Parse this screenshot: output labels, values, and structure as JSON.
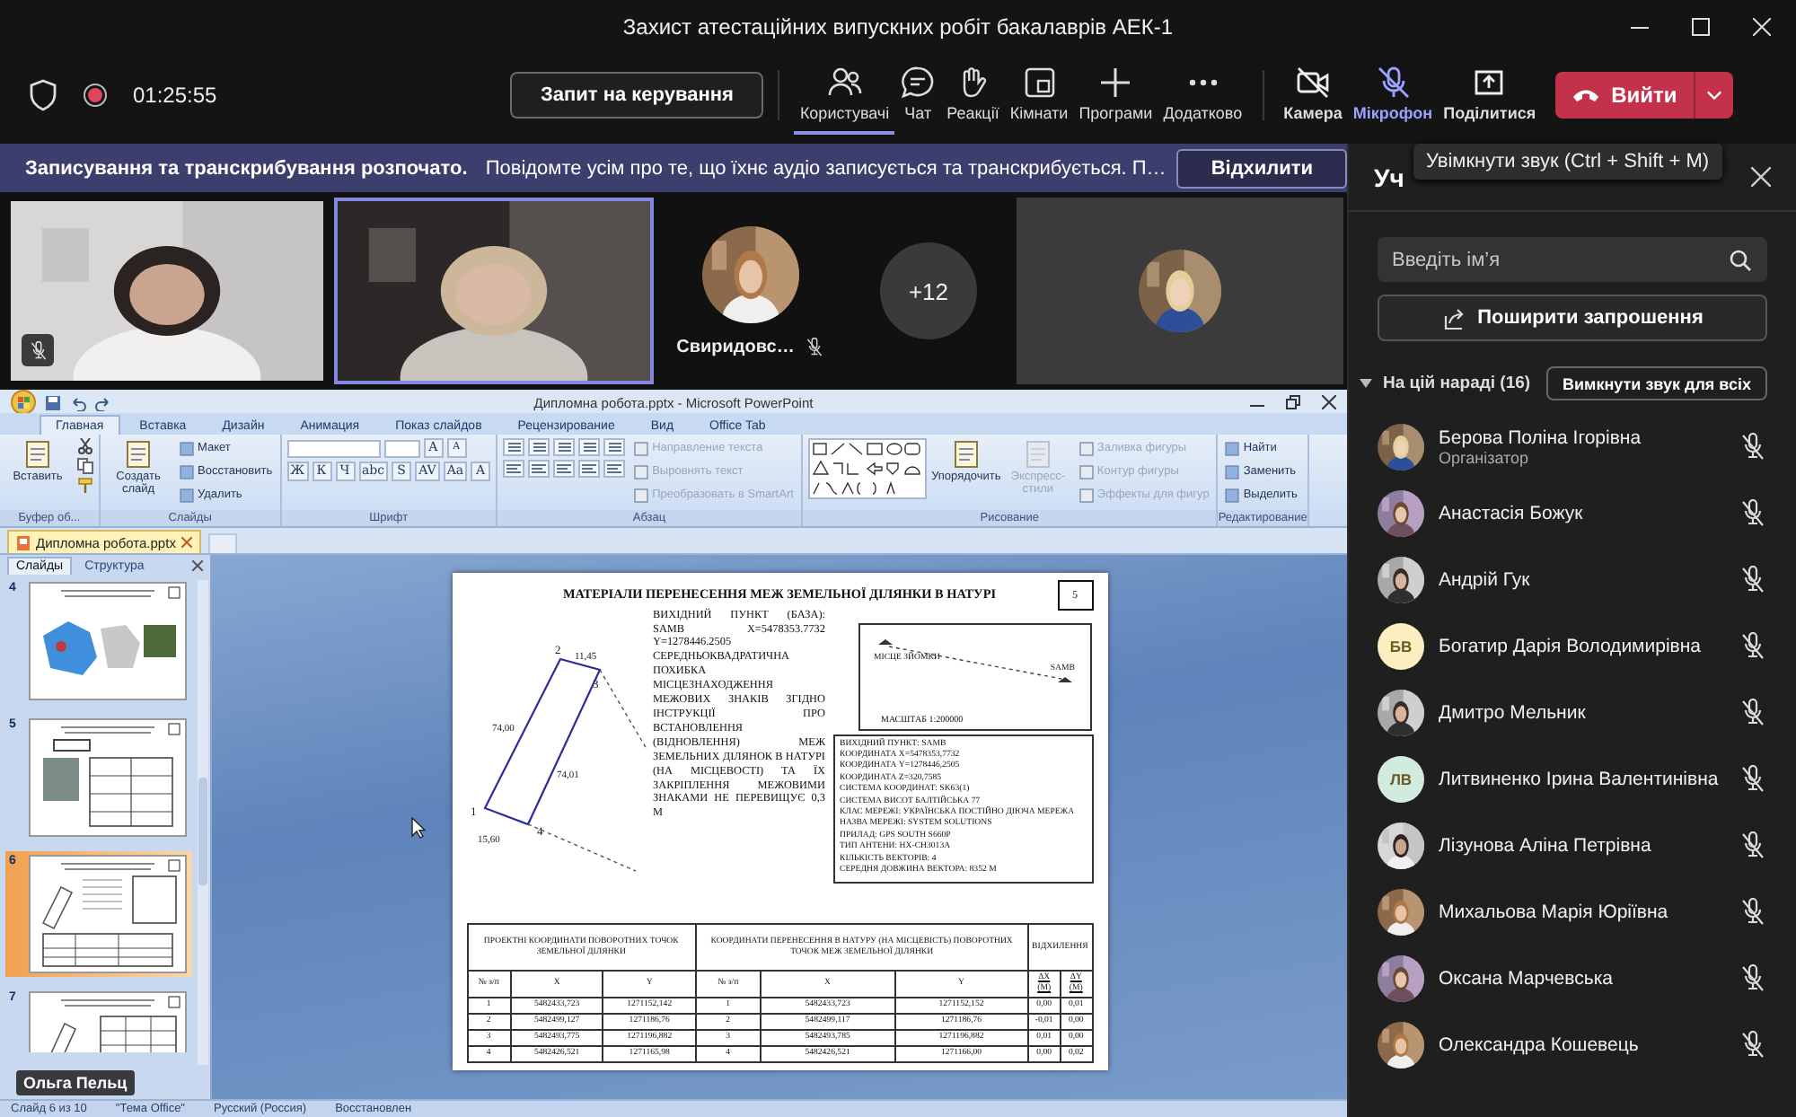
{
  "window": {
    "title": "Захист атестаційних випускних робіт бакалаврів АЕК-1"
  },
  "toolbar": {
    "recording": true,
    "timer": "01:25:55",
    "request_button": "Запит на керування",
    "tools": [
      {
        "kind": "people",
        "label": "Користувачі",
        "selected": true
      },
      {
        "kind": "chat",
        "label": "Чат",
        "selected": false
      },
      {
        "kind": "reactions",
        "label": "Реакції",
        "selected": false
      },
      {
        "kind": "rooms",
        "label": "Кімнати",
        "selected": false
      },
      {
        "kind": "apps",
        "label": "Програми",
        "selected": false
      },
      {
        "kind": "more",
        "label": "Додатково",
        "selected": false
      }
    ],
    "devices": [
      {
        "kind": "camera",
        "label": "Камера",
        "off": true,
        "hovered": false
      },
      {
        "kind": "mic",
        "label": "Мікрофон",
        "off": true,
        "hovered": true
      },
      {
        "kind": "share",
        "label": "Поділитися",
        "hovered": false
      }
    ],
    "leave_button": "Вийти"
  },
  "banner": {
    "title": "Записування та транскрибування розпочато.",
    "message": "Повідомте усім про те, що їхнє аудіо записується та транскрибується. П…",
    "dismiss_button": "Відхилити"
  },
  "stage": {
    "tiles": [
      {
        "kind": "video",
        "muted": true,
        "selected": false
      },
      {
        "kind": "video",
        "selected": true
      },
      {
        "kind": "avatar",
        "name": "Свиридовс…",
        "muted": true
      },
      {
        "kind": "overflow",
        "count": "+12"
      },
      {
        "kind": "avatar_only"
      }
    ]
  },
  "shared_screen": {
    "app_title": "Дипломна робота.pptx - Microsoft PowerPoint",
    "tabs": [
      {
        "label": "Главная",
        "selected": true
      },
      {
        "label": "Вставка",
        "selected": false
      },
      {
        "label": "Дизайн",
        "selected": false
      },
      {
        "label": "Анимация",
        "selected": false
      },
      {
        "label": "Показ слайдов",
        "selected": false
      },
      {
        "label": "Рецензирование",
        "selected": false
      },
      {
        "label": "Вид",
        "selected": false
      },
      {
        "label": "Office Tab",
        "selected": false
      }
    ],
    "ribbon": [
      {
        "label": "Буфер об...",
        "columns": [
          [
            {
              "kind": "large",
              "label": "Вставить",
              "disabled": false
            }
          ],
          [
            {
              "kind": "clip_tools"
            }
          ]
        ]
      },
      {
        "label": "Слайды",
        "columns": [
          [
            {
              "kind": "large",
              "label": "Создать слайд",
              "disabled": false
            }
          ],
          [
            {
              "kind": "small",
              "label": "Макет",
              "disabled": false
            },
            {
              "kind": "small",
              "label": "Восстановить",
              "disabled": false
            },
            {
              "kind": "small",
              "label": "Удалить",
              "disabled": false
            }
          ]
        ]
      },
      {
        "label": "Шрифт",
        "columns": [
          [
            {
              "kind": "font_fields",
              "glyphs": [
                "A",
                "A"
              ]
            },
            {
              "kind": "glyphs",
              "glyphs": [
                "Ж",
                "К",
                "Ч",
                "abc",
                "S",
                "AV",
                "Aa",
                "A"
              ]
            }
          ]
        ]
      },
      {
        "label": "Абзац",
        "columns": [
          [
            {
              "kind": "para_tools"
            }
          ],
          [
            {
              "kind": "small",
              "label": "Направление текста",
              "disabled": true
            },
            {
              "kind": "small",
              "label": "Выровнять текст",
              "disabled": true
            },
            {
              "kind": "small",
              "label": "Преобразовать в SmartArt",
              "disabled": true
            }
          ]
        ]
      },
      {
        "label": "Рисование",
        "columns": [
          [
            {
              "kind": "shapes"
            }
          ],
          [
            {
              "kind": "large",
              "label": "Упорядочить",
              "disabled": false
            }
          ],
          [
            {
              "kind": "large",
              "label": "Экспресс-стили",
              "disabled": true
            }
          ],
          [
            {
              "kind": "small",
              "label": "Заливка фигуры",
              "disabled": true
            },
            {
              "kind": "small",
              "label": "Контур фигуры",
              "disabled": true
            },
            {
              "kind": "small",
              "label": "Эффекты для фигур",
              "disabled": true
            }
          ]
        ]
      },
      {
        "label": "Редактирование",
        "columns": [
          [
            {
              "kind": "small",
              "label": "Найти",
              "disabled": false
            },
            {
              "kind": "small",
              "label": "Заменить",
              "disabled": false
            },
            {
              "kind": "small",
              "label": "Выделить",
              "disabled": false
            }
          ]
        ]
      }
    ],
    "document_tab": "Дипломна робота.pptx",
    "panel_tabs": [
      {
        "label": "Слайды",
        "selected": true
      },
      {
        "label": "Структура",
        "selected": false
      }
    ],
    "thumbnails": [
      {
        "number": "4",
        "selected": false
      },
      {
        "number": "5",
        "selected": false
      },
      {
        "number": "6",
        "selected": true
      },
      {
        "number": "7",
        "selected": false
      }
    ],
    "slide": {
      "number": "5",
      "title": "МАТЕРІАЛИ ПЕРЕНЕСЕННЯ МЕЖ ЗЕМЕЛЬНОЇ ДІЛЯНКИ В НАТУРІ",
      "plan_labels": [
        {
          "kind": "point",
          "text": "2"
        },
        {
          "kind": "length",
          "text": "11,45"
        },
        {
          "kind": "point",
          "text": "3"
        },
        {
          "kind": "length",
          "text": "74,00"
        },
        {
          "kind": "length",
          "text": "74,01"
        },
        {
          "kind": "point",
          "text": "1"
        },
        {
          "kind": "point",
          "text": "4"
        },
        {
          "kind": "length",
          "text": "15,60"
        }
      ],
      "description": "ВИХІДНИЙ ПУНКТ (БАЗА): SAMB X=5478353.7732 Y=1278446.2505 СЕРЕДНЬОКВАДРАТИЧНА ПОХИБКА МІСЦЕЗНАХОДЖЕННЯ МЕЖОВИХ ЗНАКІВ ЗГІДНО ІНСТРУКЦІЇ ПРО ВСТАНОВЛЕННЯ (ВІДНОВЛЕННЯ) МЕЖ ЗЕМЕЛЬНИХ ДІЛЯНОК В НАТУРІ (НА МІСЦЕВОСТІ) ТА ЇХ ЗАКРІПЛЕННЯ МЕЖОВИМИ ЗНАКАМИ НЕ ПЕРЕВИЩУЄ 0,3 М",
      "scheme": {
        "point": "МІСЦЕ ЗЙОМКИ",
        "base": "SAMB",
        "scale": "МАСШТАБ 1:200000"
      },
      "survey_lines": [
        "ВИХІДНИЙ ПУНКТ: SAMB",
        "КООРДИНАТА X=5478353,7732",
        "КООРДИНАТА Y=1278446,2505",
        "КООРДИНАТА Z=320,7585",
        "СИСТЕМА КООРДИНАТ: SK63(1)",
        "СИСТЕМА ВИСОТ БАЛТІЙСЬКА 77",
        "КЛАС МЕРЕЖІ: УКРАЇНСЬКА ПОСТІЙНО ДІЮЧА МЕРЕЖА",
        "НАЗВА МЕРЕЖІ: SYSTEM SOLUTIONS",
        "ПРИЛАД: GPS SOUTH S660P",
        "ТИП АНТЕНИ: HX-CH3013A",
        "КІЛЬКІСТЬ ВЕКТОРІВ: 4",
        "СЕРЕДНЯ ДОВЖИНА ВЕКТОРА: 8352 М"
      ],
      "table": {
        "groups": [
          "ПРОЕКТНІ КООРДИНАТИ ПОВОРОТНИХ ТОЧОК ЗЕМЕЛЬНОЇ ДІЛЯНКИ",
          "КООРДИНАТИ ПЕРЕНЕСЕННЯ В НАТУРУ (НА МІСЦЕВІСТЬ) ПОВОРОТНИХ ТОЧОК МЕЖ ЗЕМЕЛЬНОЇ ДІЛЯНКИ",
          "ВІДХИЛЕННЯ"
        ],
        "columns": [
          "№ з/п",
          "X",
          "Y",
          "№ з/п",
          "X",
          "Y",
          "ΔX (M)",
          "ΔY (M)"
        ],
        "rows": [
          [
            "1",
            "5482433,723",
            "1271152,142",
            "1",
            "5482433,723",
            "1271152,152",
            "0,00",
            "0,01"
          ],
          [
            "2",
            "5482499,127",
            "1271186,76",
            "2",
            "5482499,117",
            "1271186,76",
            "-0,01",
            "0,00"
          ],
          [
            "3",
            "5482493,775",
            "1271196,882",
            "3",
            "5482493,785",
            "1271196,882",
            "0,01",
            "0,00"
          ],
          [
            "4",
            "5482426,521",
            "1271165,98",
            "4",
            "5482426,521",
            "1271166,00",
            "0,00",
            "0,02"
          ]
        ]
      }
    },
    "status_bar": [
      "Слайд 6 из 10",
      "\"Тема Office\"",
      "Русский (Россия)",
      "Восстановлен"
    ],
    "presenter_name": "Ольга Пельц"
  },
  "participants": {
    "title": "Уч",
    "tooltip": "Увімкнути звук (Ctrl + Shift + M)",
    "search_placeholder": "Введіть ім’я",
    "invite_button": "Поширити запрошення",
    "section": {
      "label": "На цій нараді (16)",
      "expanded": true,
      "mute_all_button": "Вимкнути звук для всіх"
    },
    "people": [
      {
        "name": "Берова Поліна Ігорівна",
        "role": "Організатор",
        "muted": true
      },
      {
        "name": "Анастасія Божук",
        "muted": true
      },
      {
        "name": "Андрій Гук",
        "muted": true
      },
      {
        "name": "Богатир Дарія Володимирівна",
        "kind": "initials",
        "initials": "БВ",
        "color": "#fbefc2",
        "muted": true
      },
      {
        "name": "Дмитро Мельник",
        "muted": true
      },
      {
        "name": "Литвиненко Ірина Валентинівна",
        "kind": "initials",
        "initials": "ЛВ",
        "color": "#d3ebdf",
        "muted": true
      },
      {
        "name": "Лізунова Аліна Петрівна",
        "muted": true
      },
      {
        "name": "Михальова Марія Юріївна",
        "muted": true
      },
      {
        "name": "Оксана Марчевська",
        "muted": true
      },
      {
        "name": "Олександра Кошевець",
        "muted": true
      }
    ]
  }
}
